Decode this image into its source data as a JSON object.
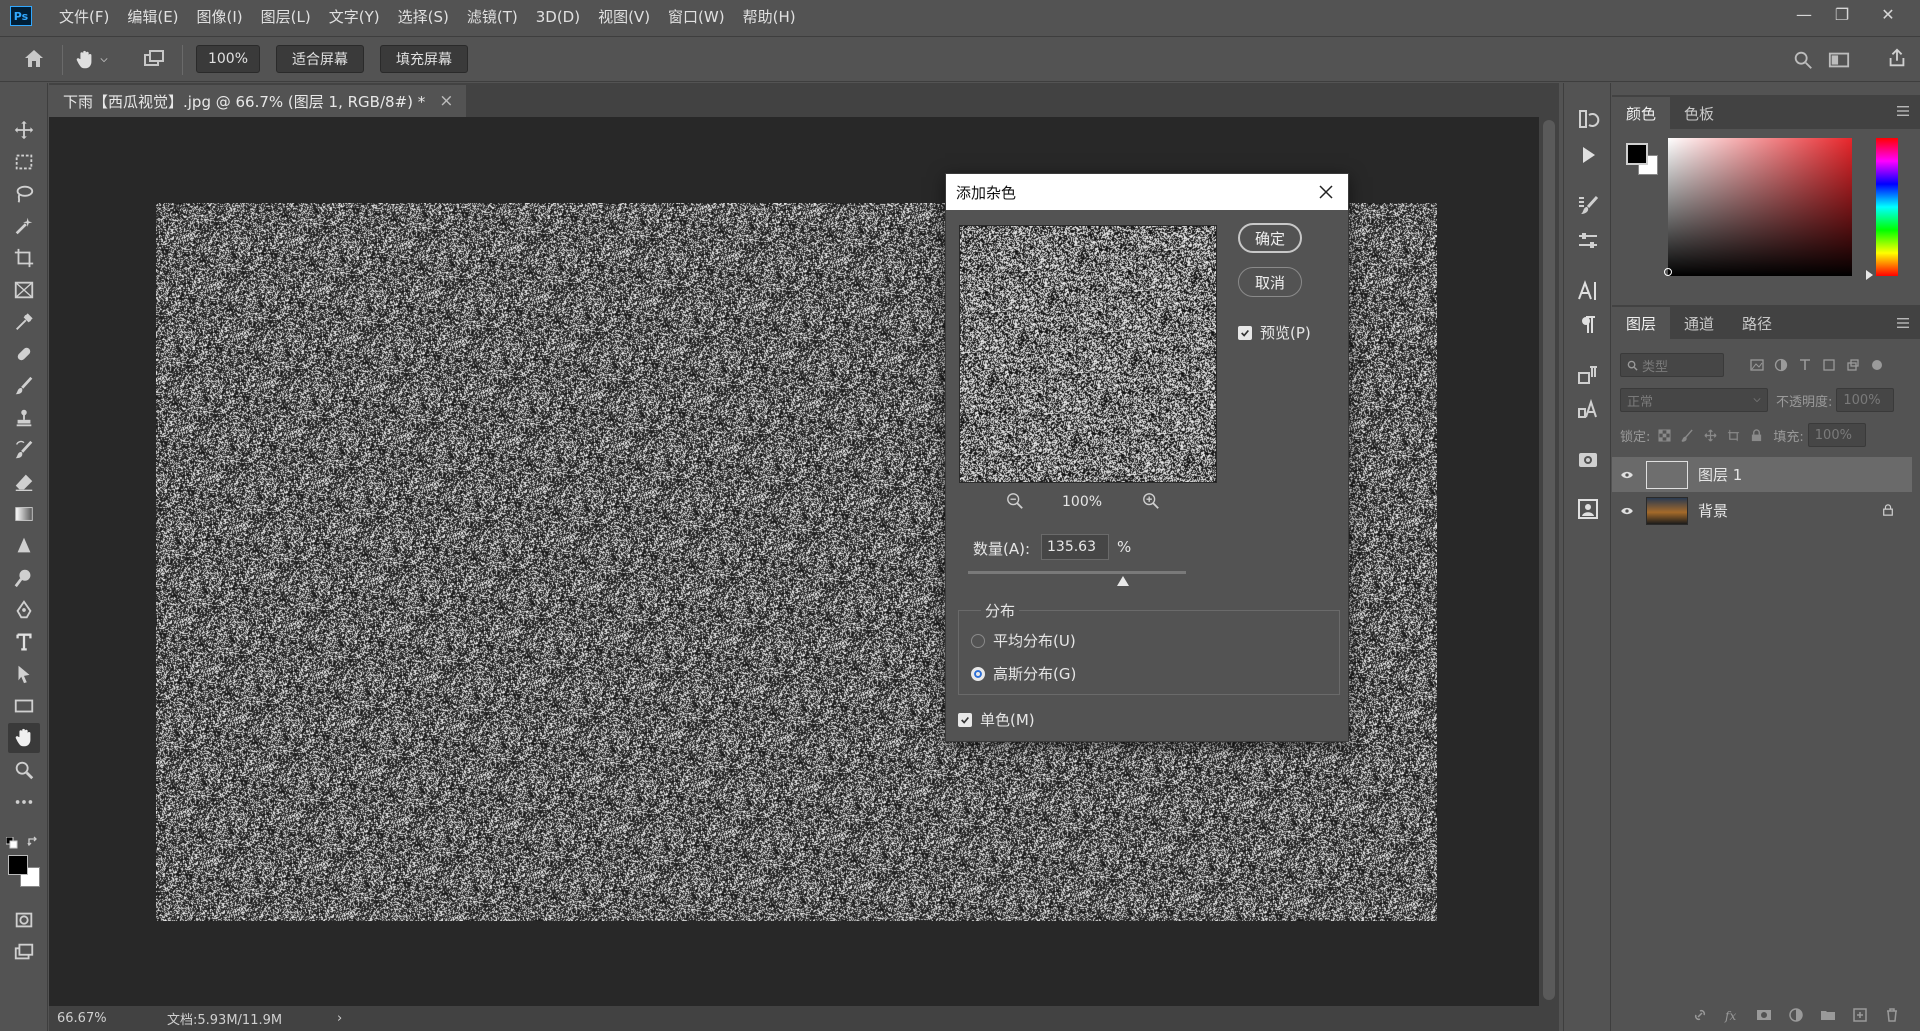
{
  "app": {
    "logo_text": "Ps"
  },
  "menu": [
    "文件(F)",
    "编辑(E)",
    "图像(I)",
    "图层(L)",
    "文字(Y)",
    "选择(S)",
    "滤镜(T)",
    "3D(D)",
    "视图(V)",
    "窗口(W)",
    "帮助(H)"
  ],
  "window_controls": {
    "minimize": "—",
    "restore": "❐",
    "close": "✕"
  },
  "options": {
    "zoom_value": "100%",
    "fit_screen": "适合屏幕",
    "fill_screen": "填充屏幕"
  },
  "document": {
    "tab_title": "下雨【西瓜视觉】.jpg @ 66.7% (图层 1, RGB/8#) *",
    "tab_close": "×"
  },
  "status": {
    "zoom": "66.67%",
    "doc_size": "文档:5.93M/11.9M",
    "arrow": "›"
  },
  "color_panel": {
    "tabs": [
      "颜色",
      "色板"
    ],
    "fg_color": "#000000",
    "bg_color": "#ffffff"
  },
  "layers_panel": {
    "tabs": [
      "图层",
      "通道",
      "路径"
    ],
    "filter_placeholder": "类型",
    "blend_mode": "正常",
    "opacity_label": "不透明度:",
    "opacity_value": "100%",
    "lock_label": "锁定:",
    "fill_label": "填充:",
    "fill_value": "100%",
    "layers": [
      {
        "name": "图层 1",
        "selected": true
      },
      {
        "name": "背景",
        "selected": false,
        "locked": true
      }
    ]
  },
  "dialog": {
    "title": "添加杂色",
    "ok": "确定",
    "cancel": "取消",
    "preview_label": "预览(P)",
    "preview_checked": true,
    "preview_zoom": "100%",
    "amount_label": "数量(A):",
    "amount_value": "135.63",
    "amount_unit": "%",
    "amount_slider_fraction": 0.71,
    "distribution_label": "分布",
    "uniform_label": "平均分布(U)",
    "gaussian_label": "高斯分布(G)",
    "selected_distribution": "gaussian",
    "monochrome_label": "单色(M)",
    "monochrome_checked": true
  }
}
